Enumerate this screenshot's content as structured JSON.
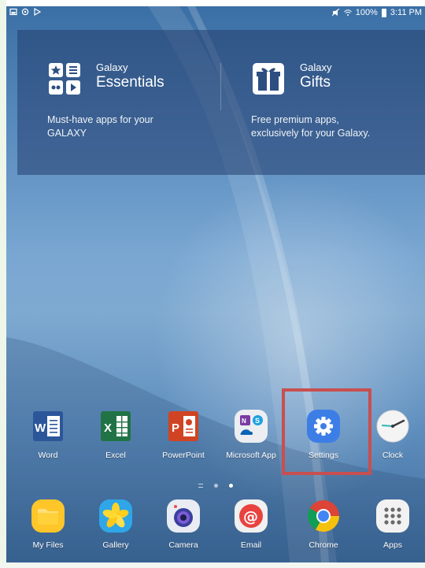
{
  "status_bar": {
    "battery": "100%",
    "time": "3:11 PM",
    "left_icons": [
      "gallery-notification-icon",
      "sync-icon",
      "play-store-icon"
    ],
    "right_icons": [
      "mute-icon",
      "wifi-icon",
      "battery-icon"
    ]
  },
  "promo": {
    "essentials": {
      "small": "Galaxy",
      "big": "Essentials",
      "desc_line1": "Must-have apps for your",
      "desc_line2": "GALAXY"
    },
    "gifts": {
      "small": "Galaxy",
      "big": "Gifts",
      "desc_line1": "Free premium apps,",
      "desc_line2": "exclusively for your Galaxy."
    }
  },
  "apps_row1": [
    {
      "label": "Word",
      "icon": "word-icon"
    },
    {
      "label": "Excel",
      "icon": "excel-icon"
    },
    {
      "label": "PowerPoint",
      "icon": "powerpoint-icon"
    },
    {
      "label": "Microsoft App",
      "icon": "microsoft-apps-folder-icon"
    },
    {
      "label": "Settings",
      "icon": "settings-icon"
    },
    {
      "label": "Clock",
      "icon": "clock-icon"
    }
  ],
  "dock": [
    {
      "label": "My Files",
      "icon": "folder-icon"
    },
    {
      "label": "Gallery",
      "icon": "gallery-icon"
    },
    {
      "label": "Camera",
      "icon": "camera-icon"
    },
    {
      "label": "Email",
      "icon": "email-icon"
    },
    {
      "label": "Chrome",
      "icon": "chrome-icon"
    },
    {
      "label": "Apps",
      "icon": "apps-grid-icon"
    }
  ],
  "colors": {
    "highlight": "#c84f4f",
    "word": "#2b579a",
    "excel": "#217346",
    "powerpoint": "#d04423",
    "settings": "#3d7ee6"
  }
}
